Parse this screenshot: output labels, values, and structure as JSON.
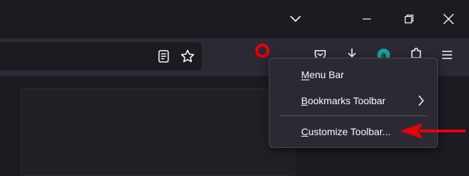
{
  "menu": {
    "items": [
      {
        "label": "Menu Bar",
        "mnemonic": "M"
      },
      {
        "label": "Bookmarks Toolbar",
        "mnemonic": "B",
        "has_submenu": true
      },
      {
        "label": "Customize Toolbar...",
        "mnemonic": "C"
      }
    ]
  },
  "toolbar": {
    "extension_badge_text": "a"
  },
  "icons": {
    "chevron": "chevron-down-icon",
    "restore": "restore-icon",
    "close": "close-icon",
    "reader": "reader-view-icon",
    "bookmark": "bookmark-star-icon",
    "pocket": "pocket-icon",
    "downloads": "downloads-icon",
    "extension": "extension-icon",
    "extensions": "extensions-puzzle-icon",
    "app_menu": "hamburger-menu-icon"
  },
  "colors": {
    "annotation": "#e8000b",
    "menu_bg": "#2b2a33",
    "toolbar_bg": "#2b2a33",
    "titlebar_bg": "#1c1b22",
    "extension_badge": "#1aa198"
  }
}
